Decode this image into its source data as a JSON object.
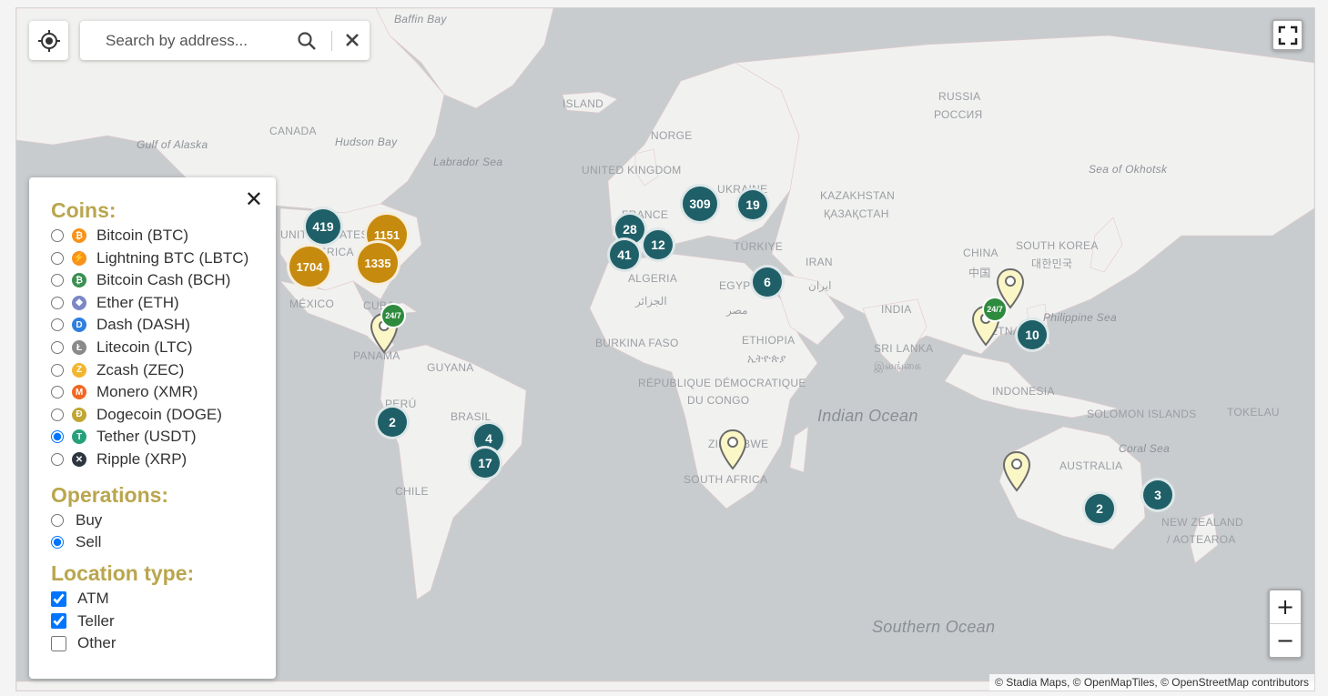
{
  "search": {
    "placeholder": "Search by address..."
  },
  "panel": {
    "coins_title": "Coins:",
    "coins": [
      {
        "label": "Bitcoin (BTC)",
        "color": "#f7931a",
        "glyph": "₿",
        "checked": false
      },
      {
        "label": "Lightning BTC (LBTC)",
        "color": "#f7931a",
        "glyph": "⚡",
        "checked": false
      },
      {
        "label": "Bitcoin Cash (BCH)",
        "color": "#3a8f52",
        "glyph": "₿",
        "checked": false
      },
      {
        "label": "Ether (ETH)",
        "color": "#7b87c7",
        "glyph": "◆",
        "checked": false
      },
      {
        "label": "Dash (DASH)",
        "color": "#2f7fe0",
        "glyph": "D",
        "checked": false
      },
      {
        "label": "Litecoin (LTC)",
        "color": "#8a8a8a",
        "glyph": "Ł",
        "checked": false
      },
      {
        "label": "Zcash (ZEC)",
        "color": "#f2b62e",
        "glyph": "Z",
        "checked": false
      },
      {
        "label": "Monero (XMR)",
        "color": "#f26822",
        "glyph": "M",
        "checked": false
      },
      {
        "label": "Dogecoin (DOGE)",
        "color": "#c2a633",
        "glyph": "Ð",
        "checked": false
      },
      {
        "label": "Tether (USDT)",
        "color": "#26a17b",
        "glyph": "T",
        "checked": true
      },
      {
        "label": "Ripple (XRP)",
        "color": "#2d3640",
        "glyph": "✕",
        "checked": false
      }
    ],
    "operations_title": "Operations:",
    "operations": [
      {
        "label": "Buy",
        "checked": false
      },
      {
        "label": "Sell",
        "checked": true
      }
    ],
    "location_title": "Location type:",
    "locations": [
      {
        "label": "ATM",
        "checked": true
      },
      {
        "label": "Teller",
        "checked": true
      },
      {
        "label": "Other",
        "checked": false
      }
    ]
  },
  "map": {
    "labels": {
      "baffin_bay": "Baffin Bay",
      "island": "ISLAND",
      "russia": "RUSSIA",
      "russia_native": "РОССИЯ",
      "canada": "CANADA",
      "gulf_alaska": "Gulf of Alaska",
      "hudson_bay": "Hudson Bay",
      "labrador_sea": "Labrador Sea",
      "norge": "NORGE",
      "uk": "UNITED KINGDOM",
      "ukraine": "UKRAINE",
      "kazakhstan": "KAZAKHSTAN",
      "kazakhstan_native": "ҚАЗАҚСТАН",
      "sea_okhotsk": "Sea of Okhotsk",
      "united_states": "UNITED STATES",
      "america": "AMERICA",
      "france": "FRANCE",
      "turkiye": "TÜRKIYE",
      "china": "CHINA",
      "china_native": "中国",
      "south_korea": "SOUTH KOREA",
      "south_korea_native": "대한민국",
      "algeria": "ALGERIA",
      "algeria_native": "الجزائر",
      "egypt": "EGYPT",
      "egypt_native": "مصر",
      "iran": "IRAN",
      "iran_native": "ایران",
      "mexico": "MÉXICO",
      "cuba": "CUBA",
      "india": "INDIA",
      "philippine_sea": "Philippine Sea",
      "vietnam": "VIETNAM",
      "panama": "PANAMA",
      "burkina_faso": "BURKINA FASO",
      "ethiopia": "ETHIOPIA",
      "ethiopia_native": "ኢትዮጵያ",
      "sri_lanka": "SRI LANKA",
      "sri_lanka_native": "இலங்கை",
      "guyana": "GUYANA",
      "drc": "RÉPUBLIQUE DÉMOCRATIQUE",
      "drc2": "DU CONGO",
      "indonesia": "INDONESIA",
      "peru": "PERÚ",
      "brasil": "BRASIL",
      "indian_ocean": "Indian Ocean",
      "solomon": "SOLOMON ISLANDS",
      "tokelau": "TOKELAU",
      "zimbabwe": "ZIMBABWE",
      "coral_sea": "Coral Sea",
      "australia": "AUSTRALIA",
      "south_africa": "SOUTH AFRICA",
      "chile": "CHILE",
      "new_zealand": "NEW ZEALAND",
      "aotearoa": "/ AOTEAROA",
      "southern_ocean": "Southern Ocean"
    },
    "clusters": [
      {
        "count": "419",
        "color": "teal"
      },
      {
        "count": "1151",
        "color": "gold"
      },
      {
        "count": "1704",
        "color": "gold"
      },
      {
        "count": "1335",
        "color": "gold"
      },
      {
        "count": "28",
        "color": "teal"
      },
      {
        "count": "41",
        "color": "teal"
      },
      {
        "count": "12",
        "color": "teal"
      },
      {
        "count": "309",
        "color": "teal"
      },
      {
        "count": "19",
        "color": "teal"
      },
      {
        "count": "6",
        "color": "teal"
      },
      {
        "count": "10",
        "color": "teal"
      },
      {
        "count": "2",
        "color": "teal"
      },
      {
        "count": "4",
        "color": "teal"
      },
      {
        "count": "17",
        "color": "teal"
      },
      {
        "count": "2",
        "color": "teal"
      },
      {
        "count": "3",
        "color": "teal"
      }
    ],
    "badge_247": "24/7",
    "zoom_in": "+",
    "zoom_out": "−",
    "attribution": "© Stadia Maps, © OpenMapTiles, © OpenStreetMap contributors"
  }
}
